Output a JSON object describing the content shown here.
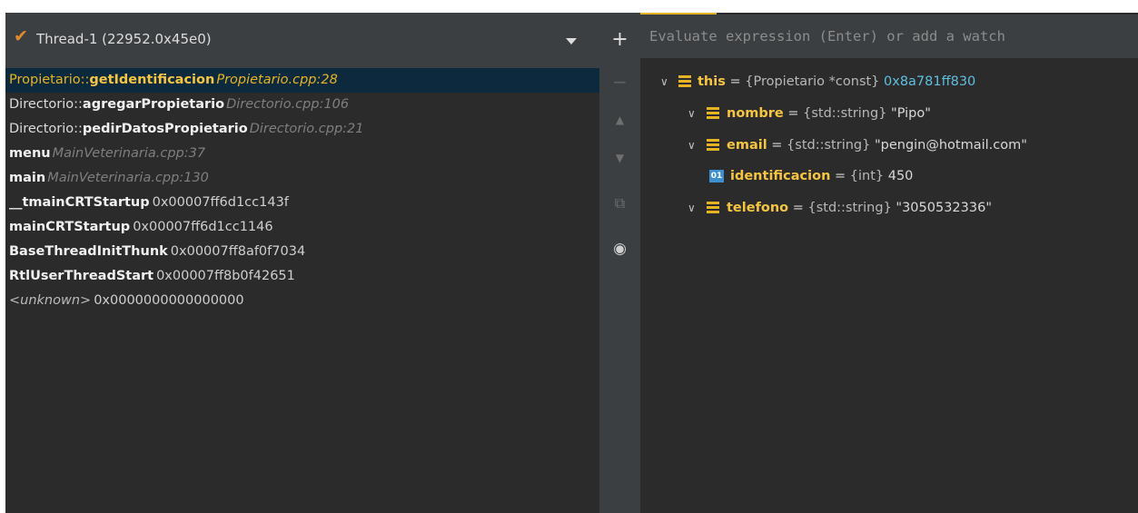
{
  "thread": {
    "label": "Thread-1 (22952.0x45e0)"
  },
  "frames": [
    {
      "cls": "Propietario::",
      "fn": "getIdentificacion",
      "loc": "Propietario.cpp:28",
      "addr": ""
    },
    {
      "cls": "Directorio::",
      "fn": "agregarPropietario",
      "loc": "Directorio.cpp:106",
      "addr": ""
    },
    {
      "cls": "Directorio::",
      "fn": "pedirDatosPropietario",
      "loc": "Directorio.cpp:21",
      "addr": ""
    },
    {
      "cls": "",
      "fn": "menu",
      "loc": "MainVeterinaria.cpp:37",
      "addr": ""
    },
    {
      "cls": "",
      "fn": "main",
      "loc": "MainVeterinaria.cpp:130",
      "addr": ""
    },
    {
      "cls": "",
      "fn": "__tmainCRTStartup",
      "loc": "",
      "addr": "0x00007ff6d1cc143f"
    },
    {
      "cls": "",
      "fn": "mainCRTStartup",
      "loc": "",
      "addr": "0x00007ff6d1cc1146"
    },
    {
      "cls": "",
      "fn": "BaseThreadInitThunk",
      "loc": "",
      "addr": "0x00007ff8af0f7034"
    },
    {
      "cls": "",
      "fn": "RtlUserThreadStart",
      "loc": "",
      "addr": "0x00007ff8b0f42651"
    },
    {
      "cls": "",
      "fn": "",
      "unknown": "<unknown>",
      "loc": "",
      "addr": "0x0000000000000000"
    }
  ],
  "evaluate": {
    "placeholder": "Evaluate expression (Enter) or add a watch"
  },
  "toolbar": {
    "add": "+",
    "remove": "−",
    "up": "▲",
    "down": "▼",
    "copy": "⧉",
    "watch": "◉"
  },
  "variables": {
    "this": {
      "name": "this",
      "eq": " = ",
      "type": "{Propietario *const} ",
      "value": "0x8a781ff830"
    },
    "nombre": {
      "name": "nombre",
      "eq": " = ",
      "type": "{std::string} ",
      "value": "\"Pipo\""
    },
    "email": {
      "name": "email",
      "eq": " = ",
      "type": "{std::string} ",
      "value": "\"pengin@hotmail.com\""
    },
    "identificacion": {
      "name": "identificacion",
      "eq": " = ",
      "type": "{int} ",
      "value": "450",
      "icon_text": "01"
    },
    "telefono": {
      "name": "telefono",
      "eq": " = ",
      "type": "{std::string} ",
      "value": "\"3050532336\""
    }
  },
  "colors": {
    "accent": "#e6b422",
    "selection": "#0d293e",
    "address": "#5fbfe0",
    "int_icon": "#3d8fd0"
  }
}
